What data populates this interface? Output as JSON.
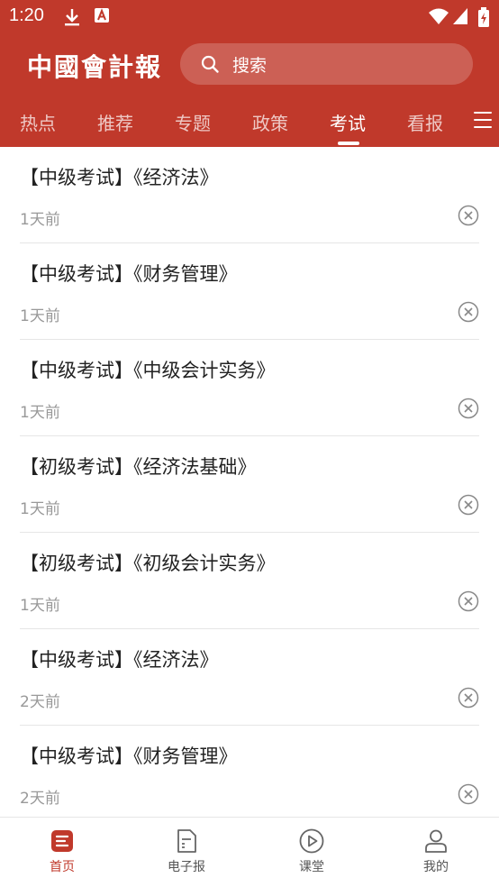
{
  "status_bar": {
    "time": "1:20"
  },
  "header": {
    "logo_text": "中國會計報",
    "search_placeholder": "搜索"
  },
  "tabs": [
    {
      "label": "热点",
      "active": false
    },
    {
      "label": "推荐",
      "active": false
    },
    {
      "label": "专题",
      "active": false
    },
    {
      "label": "政策",
      "active": false
    },
    {
      "label": "考试",
      "active": true
    },
    {
      "label": "看报",
      "active": false
    }
  ],
  "list": [
    {
      "title": "【中级考试】《经济法》",
      "time": "1天前"
    },
    {
      "title": "【中级考试】《财务管理》",
      "time": "1天前"
    },
    {
      "title": "【中级考试】《中级会计实务》",
      "time": "1天前"
    },
    {
      "title": "【初级考试】《经济法基础》",
      "time": "1天前"
    },
    {
      "title": "【初级考试】《初级会计实务》",
      "time": "1天前"
    },
    {
      "title": "【中级考试】《经济法》",
      "time": "2天前"
    },
    {
      "title": "【中级考试】《财务管理》",
      "time": "2天前"
    }
  ],
  "bottom_nav": [
    {
      "label": "首页",
      "icon": "home-icon",
      "active": true
    },
    {
      "label": "电子报",
      "icon": "newspaper-icon",
      "active": false
    },
    {
      "label": "课堂",
      "icon": "play-icon",
      "active": false
    },
    {
      "label": "我的",
      "icon": "user-icon",
      "active": false
    }
  ],
  "colors": {
    "brand": "#c0392b",
    "text": "#222222",
    "muted": "#999999"
  }
}
